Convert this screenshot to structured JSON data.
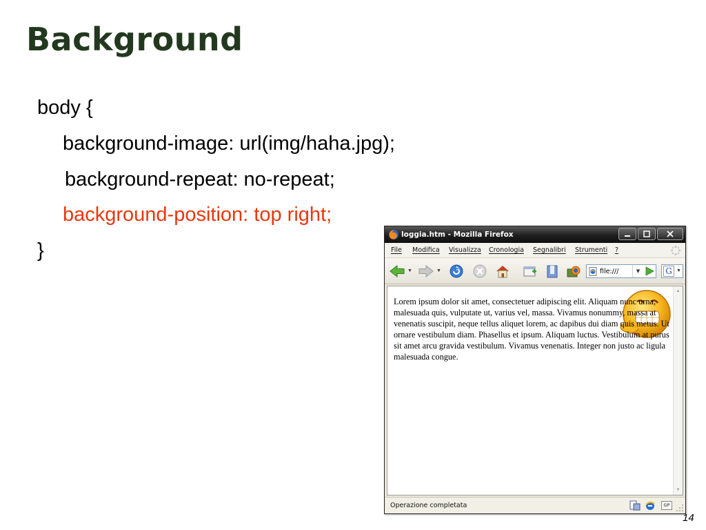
{
  "slide": {
    "title": "Background",
    "page_number": "14",
    "code_lines": [
      "body {",
      "background-image: url(img/haha.jpg);",
      "background-repeat: no-repeat;",
      "background-position: top right;",
      "}"
    ],
    "highlight_color": "#e8380d",
    "title_color": "#23391f"
  },
  "browser": {
    "window_title": "loggia.htm - Mozilla Firefox",
    "window_controls": [
      "minimize",
      "maximize",
      "close"
    ],
    "menu": [
      {
        "label": "File",
        "icon": ""
      },
      {
        "label": "Modifica"
      },
      {
        "label": "Visualizza"
      },
      {
        "label": "Cronologia"
      },
      {
        "label": "Segnalibri"
      },
      {
        "label": "Strumenti"
      },
      {
        "label": "?"
      }
    ],
    "toolbar": {
      "icons": [
        "back-arrow-icon",
        "forward-arrow-icon",
        "reload-icon",
        "stop-icon",
        "home-icon",
        "new-tab-icon",
        "bookmarks-icon",
        "firefox-extension-icon"
      ],
      "address_value": "file:///",
      "search_engine_label": "G"
    },
    "content": {
      "text": "Lorem ipsum dolor sit amet, consectetuer adipiscing elit. Aliquam nunc urna, malesuada quis, vulputate ut, varius vel, massa. Vivamus nonummy, massa at venenatis suscipit, neque tellus aliquet lorem, ac dapibus dui diam quis metus. Ut ornare vestibulum diam. Phasellus et ipsum. Aliquam luctus. Vestibulum at purus sit amet arcu gravida vestibulum. Vivamus venenatis. Integer non justo ac ligula malesuada congue.",
      "background_image": "smiley-face-icon"
    },
    "status": {
      "text": "Operazione completata",
      "badge": "GP"
    }
  }
}
